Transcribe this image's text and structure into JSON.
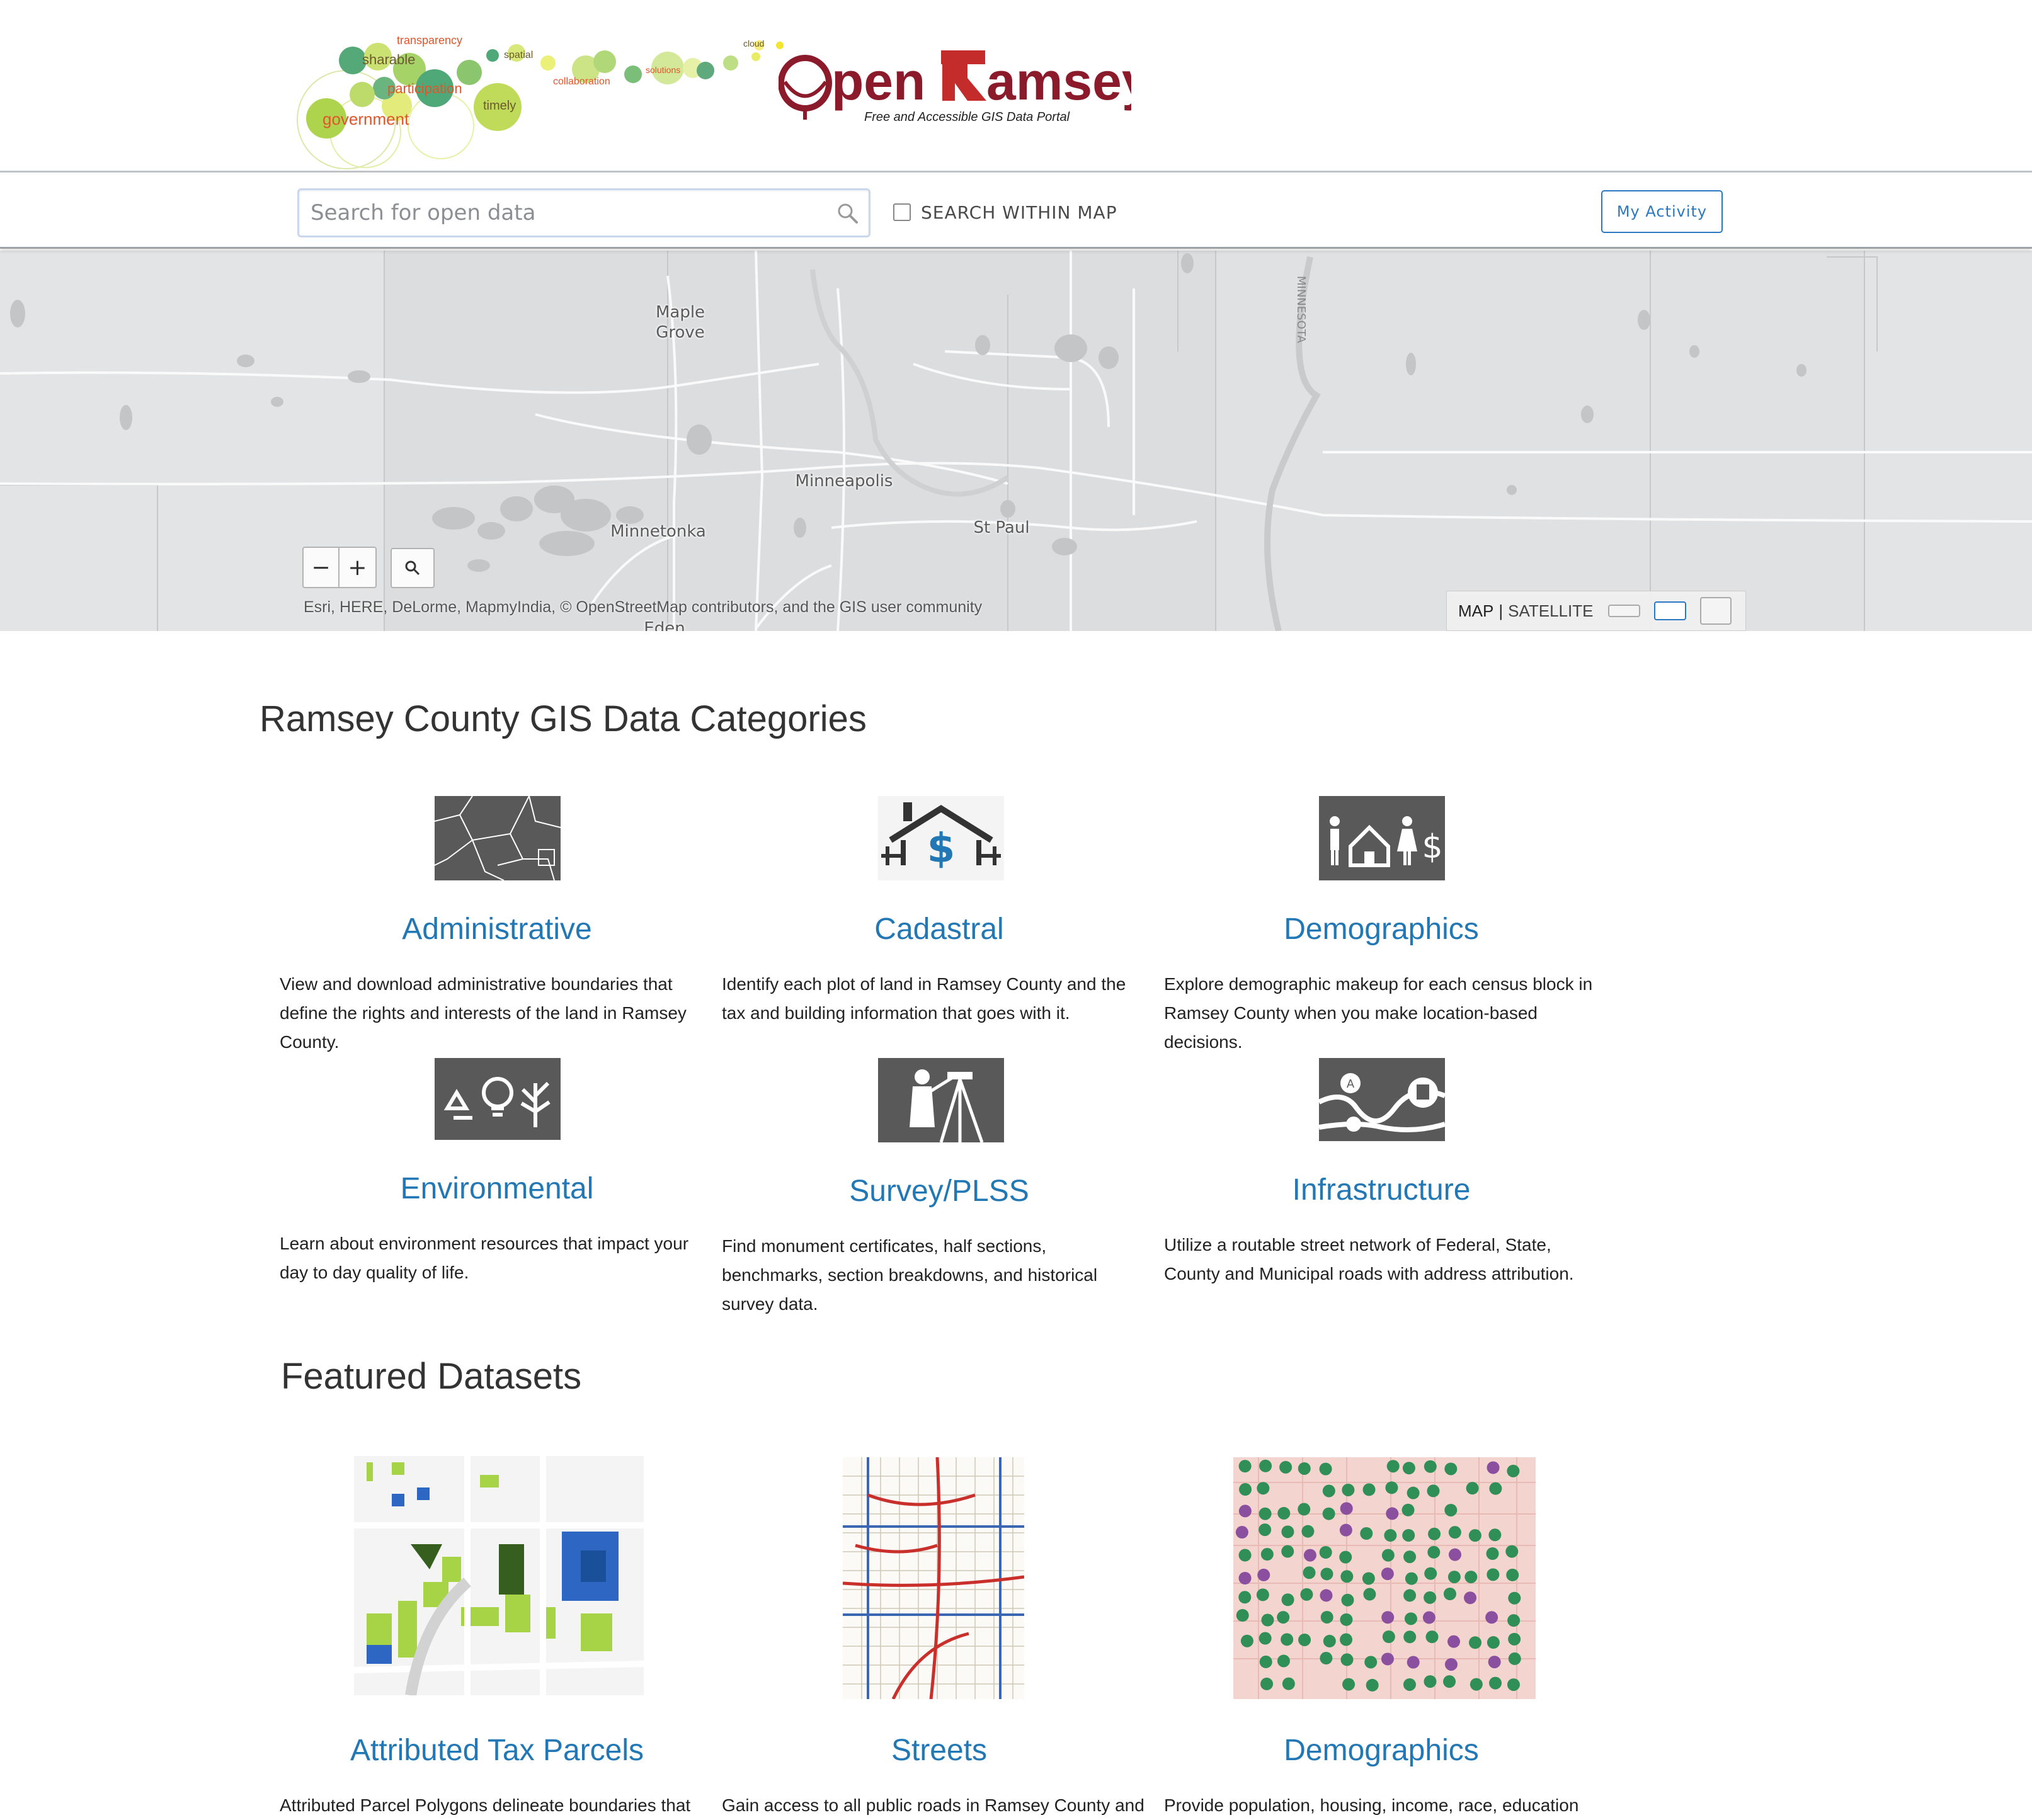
{
  "header": {
    "brand_name": "OpenRamsey",
    "brand_prefix": "pen",
    "brand_suffix": "amsey",
    "brand_tagline": "Free and Accessible GIS Data Portal",
    "word_cloud": [
      "transparency",
      "sharable",
      "spatial",
      "cloud",
      "participation",
      "collaboration",
      "solutions",
      "timely",
      "government"
    ]
  },
  "toolbar": {
    "search_placeholder": "Search for open data",
    "search_within_map_label": "SEARCH WITHIN MAP",
    "my_activity_label": "My Activity"
  },
  "map": {
    "cities": [
      "Maple Grove",
      "Minneapolis",
      "Minnetonka",
      "St Paul",
      "Eden"
    ],
    "zoom_out_label": "−",
    "zoom_in_label": "+",
    "attribution": "Esri, HERE, DeLorme, MapmyIndia, © OpenStreetMap contributors, and the GIS user community",
    "basemap_map_label": "MAP",
    "basemap_separator": "|",
    "basemap_satellite_label": "SATELLITE",
    "road_label": "MINNESOTA"
  },
  "categories": {
    "heading": "Ramsey County GIS Data Categories",
    "items": [
      {
        "title": "Administrative",
        "description": "View and download administrative boundaries that define the rights and interests of the land in Ramsey County.",
        "icon": "boundary-map-icon"
      },
      {
        "title": "Cadastral",
        "description": "Identify each plot of land in Ramsey County and the tax and building information that goes with it.",
        "icon": "house-dollar-icon"
      },
      {
        "title": "Demographics",
        "description": "Explore demographic makeup for each census block in Ramsey County when you make location-based decisions.",
        "icon": "people-house-dollar-icon"
      },
      {
        "title": "Environmental",
        "description": "Learn about environment resources that impact your day to day quality of life.",
        "icon": "recycle-bulb-tree-icon"
      },
      {
        "title": "Survey/PLSS",
        "description": "Find monument certificates, half sections, benchmarks, section breakdowns, and historical survey data.",
        "icon": "surveyor-icon"
      },
      {
        "title": "Infrastructure",
        "description": "Utilize a routable street network of Federal, State, County and Municipal roads with address attribution.",
        "icon": "route-transit-icon"
      }
    ]
  },
  "featured": {
    "heading": "Featured Datasets",
    "items": [
      {
        "title": "Attributed Tax Parcels",
        "description": "Attributed Parcel Polygons delineate boundaries that"
      },
      {
        "title": "Streets",
        "description": "Gain access to all public roads in Ramsey County and"
      },
      {
        "title": "Demographics",
        "description": "Provide population, housing, income, race, education"
      }
    ]
  },
  "colors": {
    "accent_blue": "#2277b5",
    "brand_red": "#8b1a2b",
    "icon_gray": "#595959",
    "map_bg": "#e3e4e5"
  }
}
